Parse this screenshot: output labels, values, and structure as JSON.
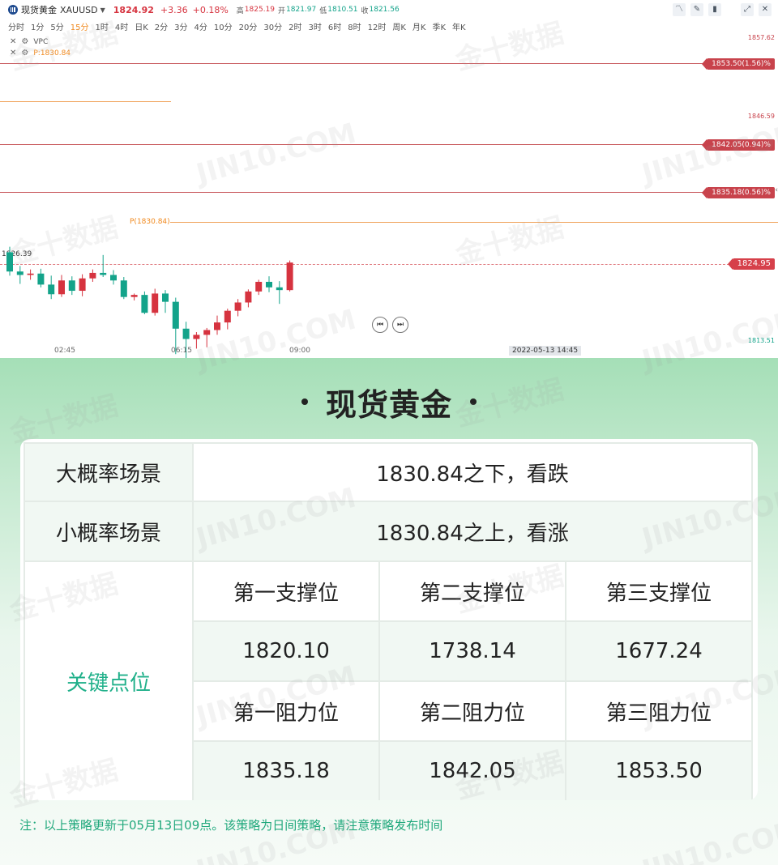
{
  "header": {
    "name": "现货黄金",
    "symbol": "XAUUSD",
    "price": "1824.92",
    "change": "+3.36",
    "change_pct": "+0.18%",
    "high_label": "高",
    "high": "1825.19",
    "open_label": "开",
    "open": "1821.97",
    "low_label": "低",
    "low": "1810.51",
    "close_label": "收",
    "close": "1821.56"
  },
  "intervals": [
    "分时",
    "1分",
    "5分",
    "15分",
    "1时",
    "4时",
    "日K",
    "2分",
    "3分",
    "4分",
    "10分",
    "20分",
    "30分",
    "2时",
    "3时",
    "6时",
    "8时",
    "12时",
    "周K",
    "月K",
    "季K",
    "年K"
  ],
  "active_interval": "15分",
  "indicators": {
    "vpc": "VPC",
    "pivot": "P:1830.84"
  },
  "chart": {
    "axis_top": "1857.62",
    "axis_mid": "1846.59",
    "axis_low": "1813.51",
    "tag_r3": "1853.50(1.56)%",
    "tag_r2": "1842.05(0.94)%",
    "tag_r1": "1835.18(0.56)%",
    "tag_current": "1824.95",
    "pivot_label": "P(1830.84)",
    "current_level_label": "1826.39",
    "times": [
      "02:45",
      "06:15",
      "09:00"
    ],
    "crosshair_time": "2022-05-13 14:45"
  },
  "chart_data": {
    "type": "candlestick",
    "interval": "15分",
    "ohlc": [
      [
        1826.4,
        1827.2,
        1823.0,
        1823.6
      ],
      [
        1823.6,
        1824.4,
        1821.8,
        1823.1
      ],
      [
        1823.1,
        1823.9,
        1822.4,
        1823.3
      ],
      [
        1823.3,
        1824.0,
        1821.3,
        1821.7
      ],
      [
        1821.7,
        1823.0,
        1819.6,
        1820.3
      ],
      [
        1820.3,
        1823.1,
        1819.9,
        1822.3
      ],
      [
        1822.3,
        1822.9,
        1820.2,
        1820.8
      ],
      [
        1820.8,
        1823.2,
        1820.0,
        1822.6
      ],
      [
        1822.6,
        1823.9,
        1822.1,
        1823.4
      ],
      [
        1823.4,
        1826.0,
        1822.8,
        1823.1
      ],
      [
        1823.1,
        1823.8,
        1821.7,
        1822.3
      ],
      [
        1822.3,
        1822.8,
        1819.6,
        1819.9
      ],
      [
        1819.9,
        1820.4,
        1819.4,
        1820.2
      ],
      [
        1820.2,
        1820.7,
        1817.4,
        1817.6
      ],
      [
        1817.6,
        1821.1,
        1817.2,
        1820.4
      ],
      [
        1820.4,
        1820.9,
        1817.6,
        1819.2
      ],
      [
        1819.2,
        1819.8,
        1811.6,
        1815.3
      ],
      [
        1815.3,
        1816.3,
        1810.5,
        1813.8
      ],
      [
        1813.8,
        1814.8,
        1812.4,
        1814.4
      ],
      [
        1814.4,
        1815.4,
        1812.6,
        1815.1
      ],
      [
        1815.1,
        1817.2,
        1814.4,
        1816.2
      ],
      [
        1816.2,
        1818.2,
        1815.2,
        1817.9
      ],
      [
        1817.9,
        1819.6,
        1817.1,
        1819.1
      ],
      [
        1819.1,
        1821.0,
        1818.4,
        1820.7
      ],
      [
        1820.7,
        1822.4,
        1820.2,
        1822.1
      ],
      [
        1822.1,
        1822.9,
        1820.6,
        1821.3
      ],
      [
        1821.3,
        1822.2,
        1818.9,
        1820.9
      ],
      [
        1820.9,
        1825.2,
        1820.7,
        1824.9
      ]
    ],
    "levels": {
      "pivot": 1830.84,
      "r1": 1835.18,
      "r2": 1842.05,
      "r3": 1853.5
    },
    "ylim": [
      1813.51,
      1857.62
    ],
    "xlabel": "",
    "ylabel": ""
  },
  "strategy": {
    "title": "现货黄金",
    "scenario_high_label": "大概率场景",
    "scenario_high_value": "1830.84之下，看跌",
    "scenario_low_label": "小概率场景",
    "scenario_low_value": "1830.84之上，看涨",
    "key_label": "关键点位",
    "support_labels": [
      "第一支撑位",
      "第二支撑位",
      "第三支撑位"
    ],
    "support_values": [
      "1820.10",
      "1738.14",
      "1677.24"
    ],
    "resistance_labels": [
      "第一阻力位",
      "第二阻力位",
      "第三阻力位"
    ],
    "resistance_values": [
      "1835.18",
      "1842.05",
      "1853.50"
    ],
    "note": "注：以上策略更新于05月13日09点。该策略为日间策略，请注意策略发布时间"
  },
  "colors": {
    "up": "#d6333f",
    "down": "#13a38a",
    "accent": "#20b08a",
    "pivot": "#f0891e"
  }
}
